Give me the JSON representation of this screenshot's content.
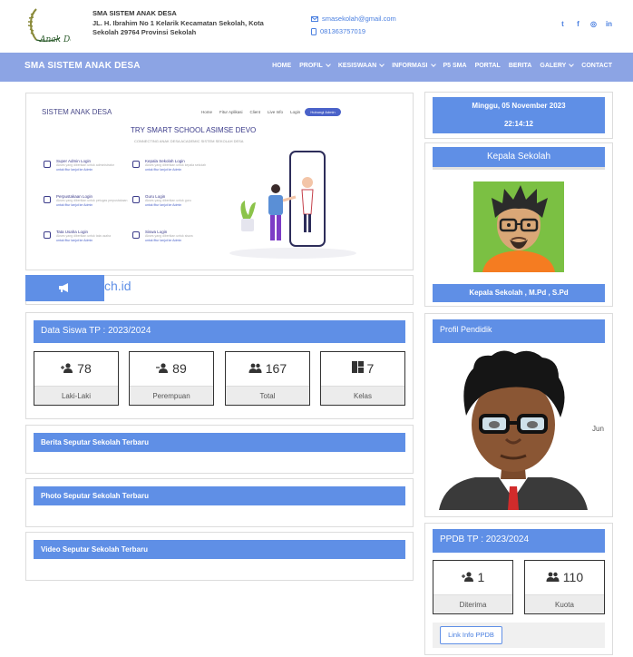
{
  "header": {
    "school_name": "SMA SISTEM ANAK DESA",
    "address": "JL. H. Ibrahim No 1 Kelarik Kecamatan Sekolah, Kota Sekolah 29764 Provinsi Sekolah",
    "email": "smasekolah@gmail.com",
    "phone": "081363757019",
    "logo_text": "Anak Desa",
    "socials": [
      "twitter-icon",
      "facebook-icon",
      "instagram-icon",
      "linkedin-icon"
    ]
  },
  "nav": {
    "brand": "SMA SISTEM ANAK DESA",
    "items": [
      {
        "label": "HOME",
        "dropdown": false
      },
      {
        "label": "PROFIL",
        "dropdown": true
      },
      {
        "label": "KESISWAAN",
        "dropdown": true
      },
      {
        "label": "INFORMASI",
        "dropdown": true
      },
      {
        "label": "P5 SMA",
        "dropdown": false
      },
      {
        "label": "PORTAL",
        "dropdown": false
      },
      {
        "label": "BERITA",
        "dropdown": false
      },
      {
        "label": "GALERY",
        "dropdown": true
      },
      {
        "label": "CONTACT",
        "dropdown": false
      }
    ]
  },
  "hero": {
    "brand": "SISTEM ANAK DESA",
    "nav": [
      "Home",
      "Fitur Aplikasi",
      "Client",
      "Live Info",
      "Login"
    ],
    "cta": "Hubungi Admin",
    "headline": "TRY SMART SCHOOL ASIMSE DEVO",
    "sub": "CONNECTING ANAK DESA ACADEMIC SISTEM SEKOLAH DESA",
    "items": [
      {
        "title": "Super Admin Login",
        "desc": "Akses yang diberikan untuk administrator",
        "link": "untuk fitur lanjut ke Admin"
      },
      {
        "title": "Kepala Sekolah Login",
        "desc": "Akses yang diberikan untuk kepala sekolah",
        "link": "untuk fitur lanjut ke Admin"
      },
      {
        "title": "Perpustakaan Login",
        "desc": "Akses yang diberikan untuk petugas perpustakaan",
        "link": "untuk fitur lanjut ke Admin"
      },
      {
        "title": "Guru Login",
        "desc": "Akses yang diberikan untuk guru",
        "link": "untuk fitur lanjut ke Admin"
      },
      {
        "title": "Tata Usaha Login",
        "desc": "Akses yang diberikan untuk tata usaha",
        "link": "untuk fitur lanjut ke Admin"
      },
      {
        "title": "Siswa Login",
        "desc": "Akses yang diberikan untuk siswa",
        "link": "untuk fitur lanjut ke Admin"
      }
    ]
  },
  "marquee": {
    "text": "ch.id"
  },
  "data_siswa": {
    "title": "Data Siswa TP : 2023/2024",
    "stats": [
      {
        "icon": "user-plus-icon",
        "value": "78",
        "label": "Laki-Laki"
      },
      {
        "icon": "user-minus-icon",
        "value": "89",
        "label": "Perempuan"
      },
      {
        "icon": "users-icon",
        "value": "167",
        "label": "Total"
      },
      {
        "icon": "grid-icon",
        "value": "7",
        "label": "Kelas"
      }
    ]
  },
  "sections": {
    "berita": "Berita Seputar Sekolah Terbaru",
    "photo": "Photo Seputar Sekolah Terbaru",
    "video": "Video Seputar Sekolah Terbaru"
  },
  "datetime": {
    "date": "Minggu, 05 November 2023",
    "time": "22:14:12"
  },
  "kepala": {
    "title": "Kepala Sekolah",
    "name": "Kepala Sekolah , M.Pd , S.Pd"
  },
  "profil": {
    "title": "Profil Pendidik",
    "caption": "Jun"
  },
  "ppdb": {
    "title": "PPDB TP : 2023/2024",
    "stats": [
      {
        "icon": "user-plus-icon",
        "value": "1",
        "label": "Diterima"
      },
      {
        "icon": "users-icon",
        "value": "110",
        "label": "Kuota"
      }
    ],
    "link": "Link Info PPDB"
  },
  "colors": {
    "accent": "#5f8fe6",
    "nav": "#8ca4e4"
  }
}
